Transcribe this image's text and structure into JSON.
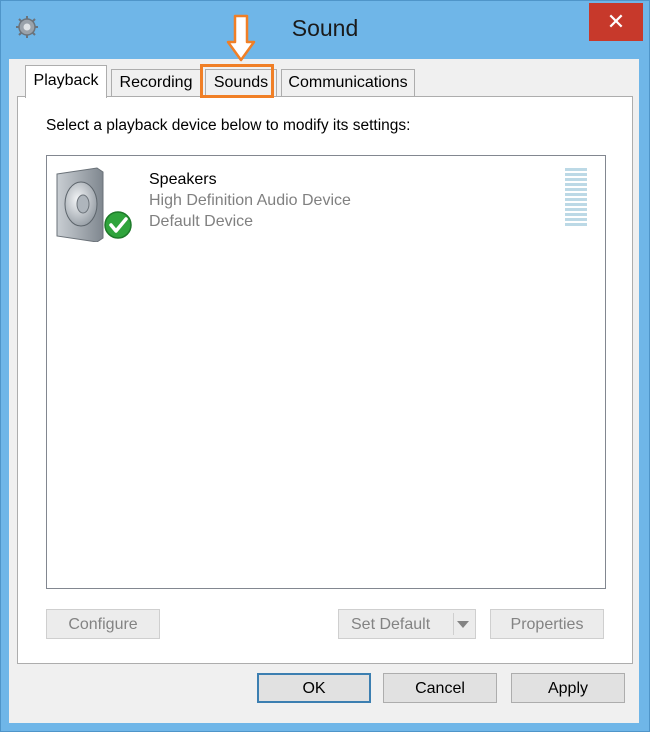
{
  "window": {
    "title": "Sound",
    "close_glyph": "✕",
    "title_icon": "speaker-gear-icon"
  },
  "tabs": [
    {
      "label": "Playback",
      "active": true
    },
    {
      "label": "Recording",
      "active": false
    },
    {
      "label": "Sounds",
      "active": false,
      "highlighted": true
    },
    {
      "label": "Communications",
      "active": false
    }
  ],
  "playback": {
    "instruction": "Select a playback device below to modify its settings:",
    "devices": [
      {
        "name": "Speakers",
        "description": "High Definition Audio Device",
        "status": "Default Device",
        "icon": "speaker-icon",
        "badge": "default-checkmark-icon"
      }
    ],
    "buttons": {
      "configure": "Configure",
      "set_default": "Set Default",
      "properties": "Properties"
    }
  },
  "dialog_buttons": {
    "ok": "OK",
    "cancel": "Cancel",
    "apply": "Apply"
  },
  "annotation": {
    "color": "#f07f26",
    "target": "Sounds"
  },
  "colors": {
    "title_bar": "#6fb6e8",
    "close_button": "#c7392b",
    "default_button_border": "#3c7fb1"
  }
}
